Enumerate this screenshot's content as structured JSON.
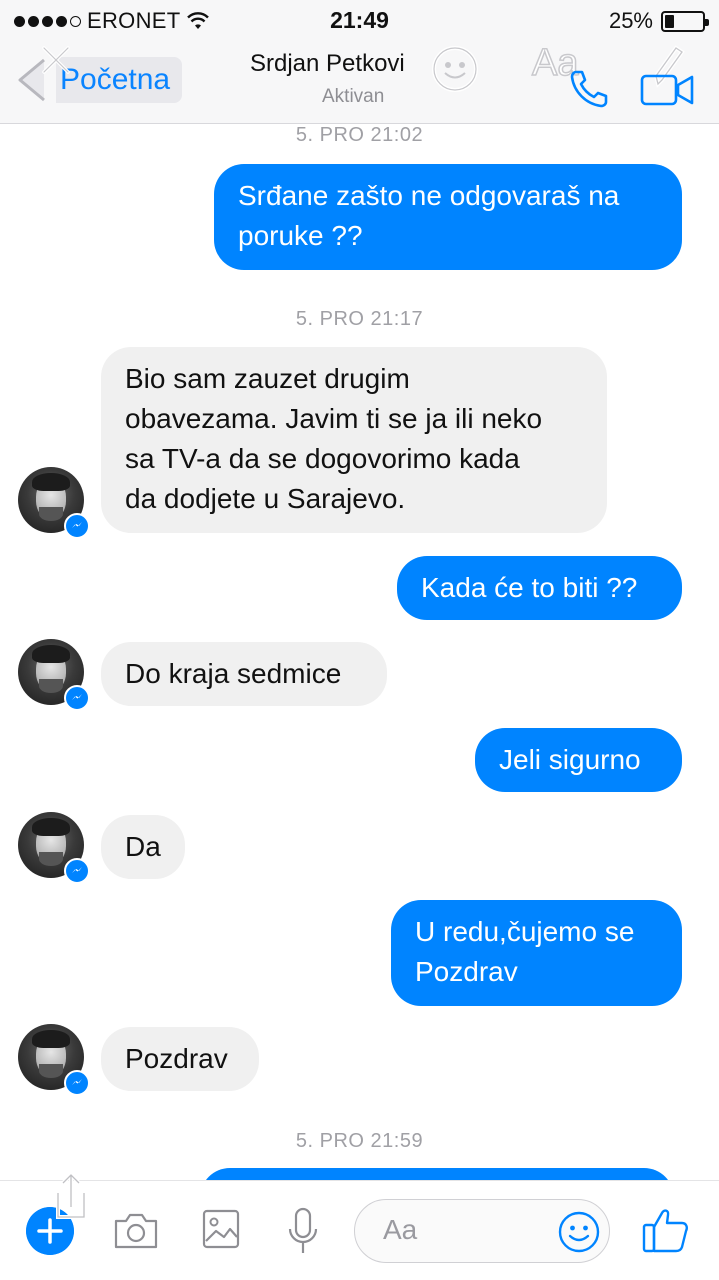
{
  "status_bar": {
    "carrier": "ERONET",
    "time": "21:49",
    "battery_percent": "25%",
    "battery_level": 0.25
  },
  "header": {
    "back_label": "Početna",
    "contact_name": "Srdjan Petkovi",
    "contact_status": "Aktivan",
    "overlay_text": "Aa"
  },
  "conversation": {
    "timestamps": [
      "5. PRO 21:02",
      "5. PRO 21:17",
      "5. PRO 21:59"
    ],
    "messages": [
      {
        "direction": "out",
        "text": "Srđane zašto ne odgovaraš na\nporuke ??"
      },
      {
        "direction": "in",
        "text": "Bio sam zauzet drugim\nobavezama. Javim ti se ja ili neko\nsa TV-a da se dogovorimo kada\nda dodjete u Sarajevo."
      },
      {
        "direction": "out",
        "text": "Kada će to biti ??"
      },
      {
        "direction": "in",
        "text": "Do kraja sedmice"
      },
      {
        "direction": "out",
        "text": "Jeli sigurno"
      },
      {
        "direction": "in",
        "text": "Da"
      },
      {
        "direction": "out",
        "text": "U redu,čujemo se\nPozdrav"
      },
      {
        "direction": "in",
        "text": "Pozdrav"
      }
    ]
  },
  "composer": {
    "placeholder": "Aa"
  },
  "colors": {
    "accent": "#0084ff",
    "incoming_bubble": "#f0f0f0",
    "timestamp": "#a0a0a5",
    "ios_link": "#0a84ff"
  },
  "icons": [
    "wifi-icon",
    "back-chevron-icon",
    "close-icon",
    "smile-icon",
    "pencil-icon",
    "phone-icon",
    "video-icon",
    "messenger-badge-icon",
    "plus-icon",
    "share-icon",
    "camera-icon",
    "image-icon",
    "microphone-icon",
    "emoji-icon",
    "thumbs-up-icon"
  ]
}
